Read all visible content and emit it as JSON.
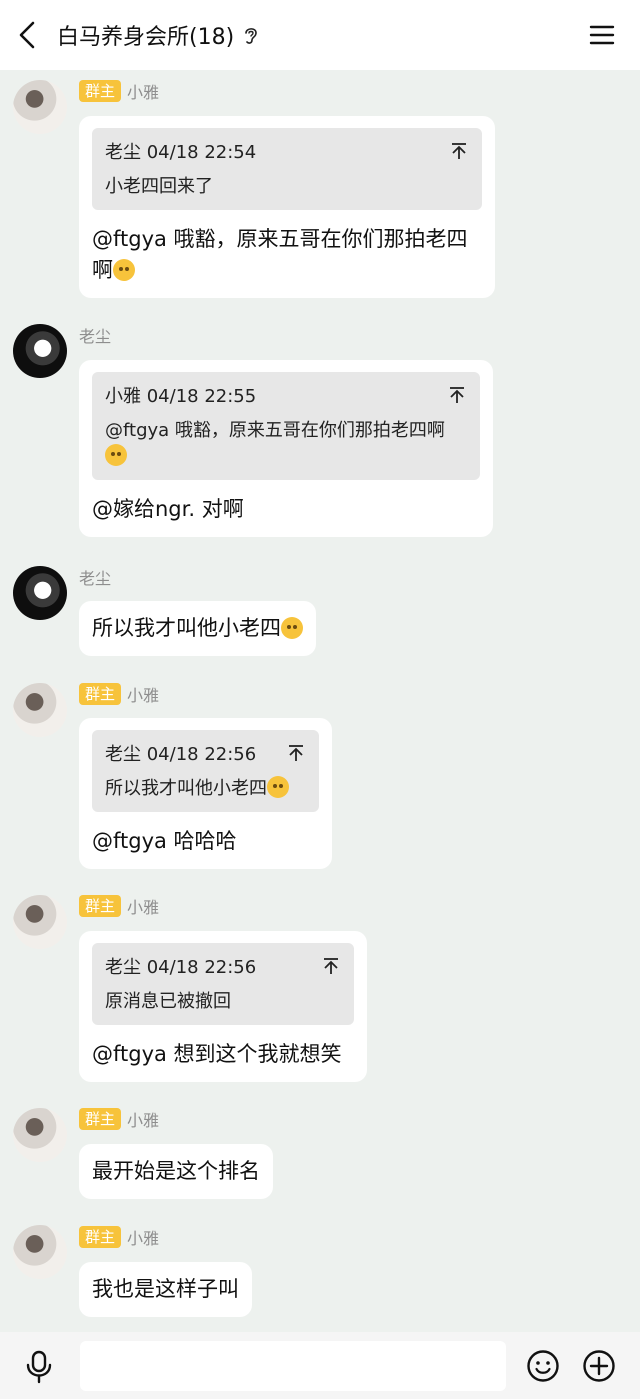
{
  "header": {
    "title": "白马养身会所(18)"
  },
  "messages": [
    {
      "badge": "群主",
      "sender": "小雅",
      "quote": {
        "author_time": "老尘 04/18 22:54",
        "text": "小老四回来了"
      },
      "text": "@ftgya 哦豁，原来五哥在你们那拍老四啊"
    },
    {
      "badge": "",
      "sender": "老尘",
      "quote": {
        "author_time": "小雅 04/18 22:55",
        "text": "@ftgya 哦豁，原来五哥在你们那拍老四啊"
      },
      "text": "@嫁给ngr. 对啊"
    },
    {
      "badge": "",
      "sender": "老尘",
      "text": "所以我才叫他小老四"
    },
    {
      "badge": "群主",
      "sender": "小雅",
      "quote": {
        "author_time": "老尘 04/18 22:56",
        "text": "所以我才叫他小老四"
      },
      "text": "@ftgya 哈哈哈"
    },
    {
      "badge": "群主",
      "sender": "小雅",
      "quote": {
        "author_time": "老尘 04/18 22:56",
        "text": "原消息已被撤回"
      },
      "text": "@ftgya 想到这个我就想笑"
    },
    {
      "badge": "群主",
      "sender": "小雅",
      "text": "最开始是这个排名"
    },
    {
      "badge": "群主",
      "sender": "小雅",
      "text": "我也是这样子叫"
    }
  ],
  "icons": {
    "back": "chevron-left-icon",
    "ear": "ear-icon",
    "menu": "hamburger-menu-icon",
    "pin": "pin-top-icon",
    "mic": "microphone-icon",
    "emoji": "smiley-icon",
    "plus": "plus-circle-icon"
  },
  "colors": {
    "background": "#edf1ee",
    "badge": "#f7c33b",
    "bubble": "#ffffff",
    "quote": "#e7e7e7"
  }
}
